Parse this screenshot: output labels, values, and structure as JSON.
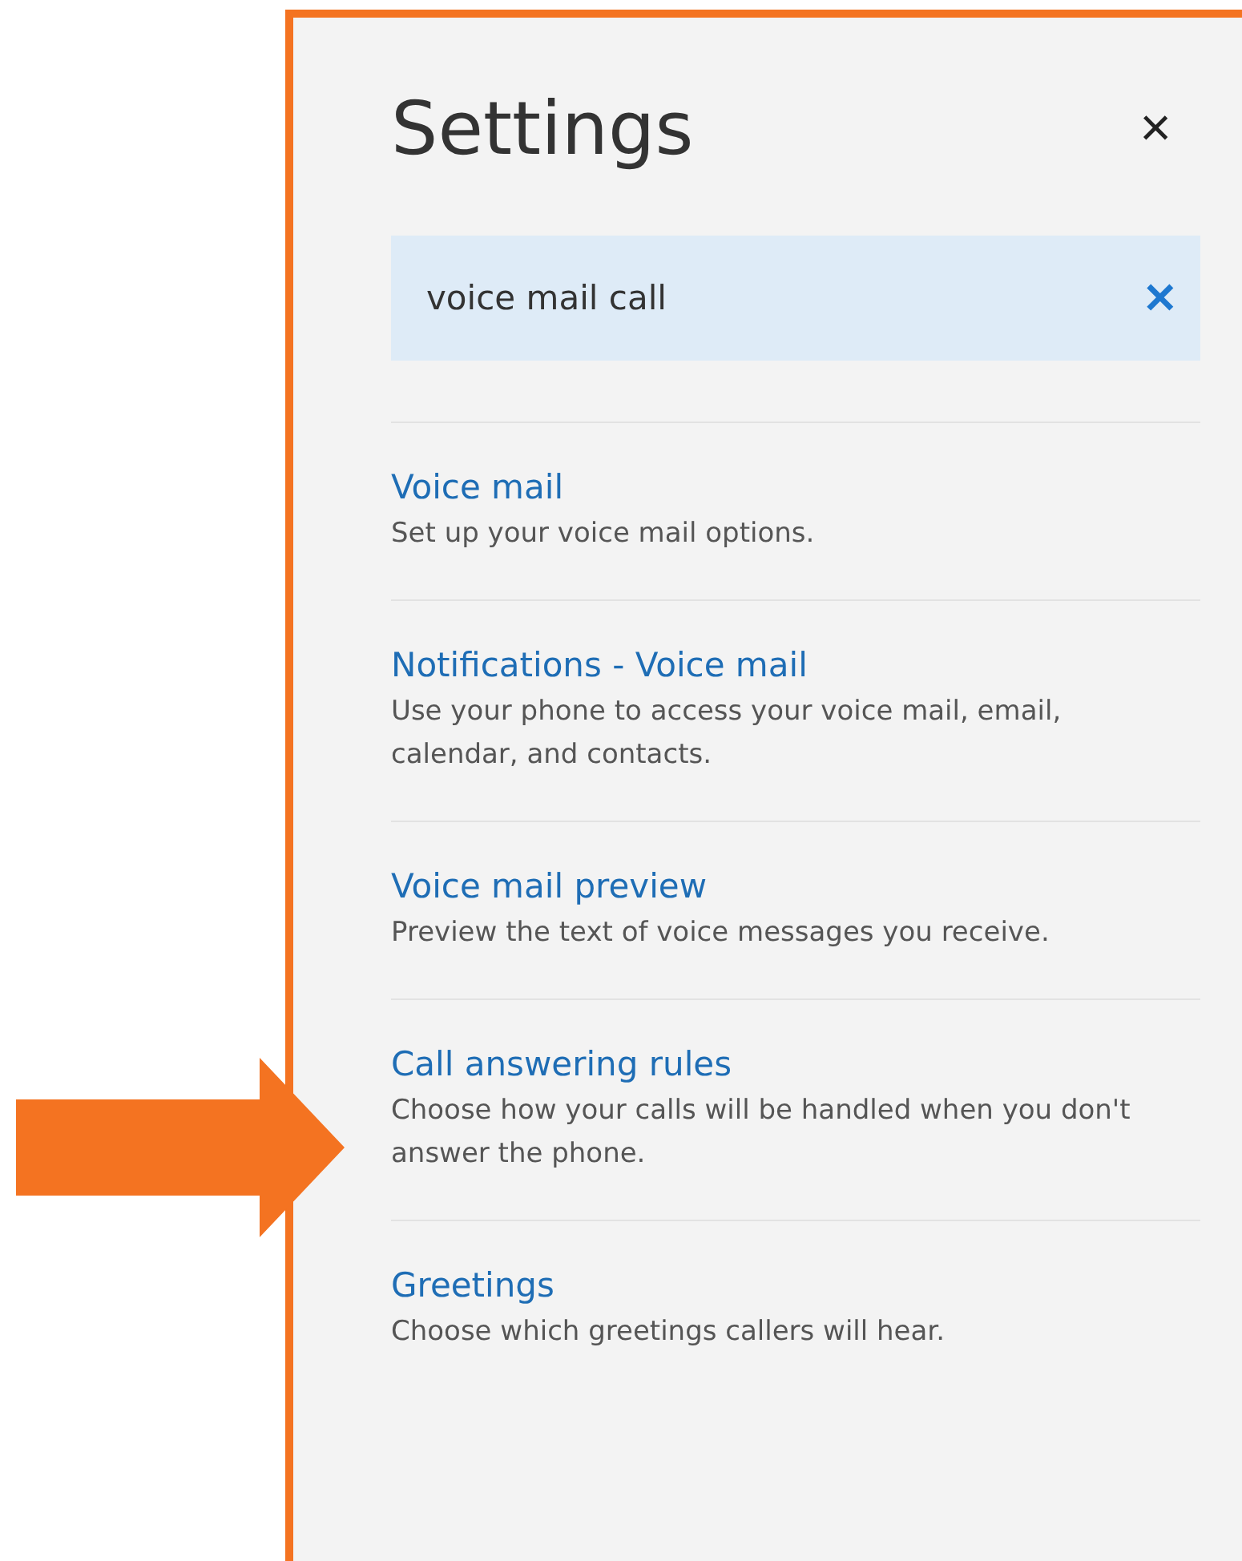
{
  "panel": {
    "title": "Settings",
    "close": "×"
  },
  "search": {
    "value": "voice mail call",
    "clear": "✕"
  },
  "results": [
    {
      "title": "Voice mail",
      "description": "Set up your voice mail options."
    },
    {
      "title": "Notifications - Voice mail",
      "description": "Use your phone to access your voice mail, email, calendar, and contacts."
    },
    {
      "title": "Voice mail preview",
      "description": "Preview the text of voice messages you receive."
    },
    {
      "title": "Call answering rules",
      "description": "Choose how your calls will be handled when you don't answer the phone."
    },
    {
      "title": "Greetings",
      "description": "Choose which greetings callers will hear."
    }
  ]
}
